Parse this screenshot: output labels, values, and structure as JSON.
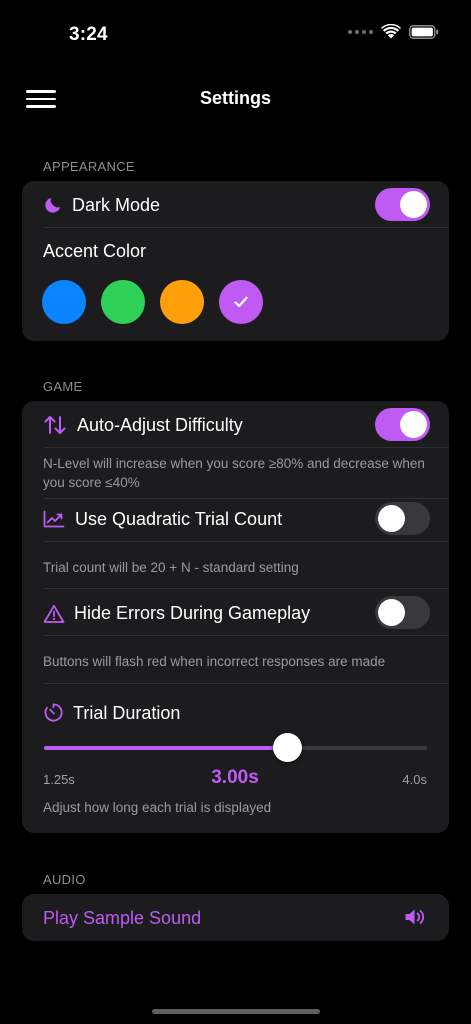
{
  "status": {
    "time": "3:24"
  },
  "nav": {
    "title": "Settings",
    "menu_icon": "hamburger-menu-icon"
  },
  "colors": {
    "accent": "#bf5af2",
    "card": "#1c1c1e",
    "toggle_off": "#39393d"
  },
  "appearance": {
    "header": "APPEARANCE",
    "dark_mode": {
      "label": "Dark Mode",
      "icon": "moon-icon",
      "enabled": true
    },
    "accent_color": {
      "label": "Accent Color",
      "options": [
        {
          "name": "blue",
          "color": "#0a84ff",
          "selected": false
        },
        {
          "name": "green",
          "color": "#30d158",
          "selected": false
        },
        {
          "name": "orange",
          "color": "#ff9f0a",
          "selected": false
        },
        {
          "name": "purple",
          "color": "#bf5af2",
          "selected": true
        }
      ]
    }
  },
  "game": {
    "header": "GAME",
    "auto_adjust": {
      "label": "Auto-Adjust Difficulty",
      "icon": "up-down-arrows-icon",
      "enabled": true,
      "description": "N-Level will increase when you score ≥80% and decrease when you score ≤40%"
    },
    "quadratic": {
      "label": "Use Quadratic Trial Count",
      "icon": "chart-line-icon",
      "enabled": false,
      "description": "Trial count will be 20 + N - standard setting"
    },
    "hide_errors": {
      "label": "Hide Errors During Gameplay",
      "icon": "warning-triangle-icon",
      "enabled": false,
      "description": "Buttons will flash red when incorrect responses are made"
    },
    "trial_duration": {
      "label": "Trial Duration",
      "icon": "timer-icon",
      "min_label": "1.25s",
      "max_label": "4.0s",
      "value_label": "3.00s",
      "min": 1.25,
      "max": 4.0,
      "value": 3.0,
      "description": "Adjust how long each trial is displayed"
    }
  },
  "audio": {
    "header": "AUDIO",
    "play_sample": {
      "label": "Play Sample Sound",
      "icon": "speaker-icon"
    }
  }
}
